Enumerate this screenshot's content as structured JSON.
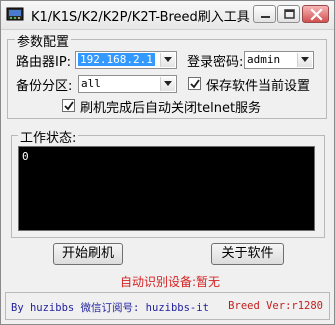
{
  "window": {
    "title": "K1/K1S/K2/K2P/K2T-Breed刷入工具",
    "app_icon": "app-icon",
    "controls": {
      "minimize": "minimize-icon",
      "maximize": "maximize-icon",
      "close": "close-icon"
    }
  },
  "params": {
    "group_label": "参数配置",
    "router_ip_label": "路由器IP:",
    "router_ip_value": "192.168.2.1",
    "password_label": "登录密码:",
    "password_value": "admin",
    "partition_label": "备份分区:",
    "partition_value": "all",
    "save_settings_label": "保存软件当前设置",
    "save_settings_checked": true,
    "auto_close_telnet_label": "刷机完成后自动关闭telnet服务",
    "auto_close_telnet_checked": true
  },
  "status": {
    "group_label": "工作状态:",
    "text": "0"
  },
  "actions": {
    "start_label": "开始刷机",
    "about_label": "关于软件"
  },
  "device": {
    "text": "自动识别设备:暂无"
  },
  "footer": {
    "author": "By huzibbs 微信订阅号: huzibbs-it",
    "version": "Breed Ver:r1280"
  },
  "colors": {
    "device_text": "#d42323",
    "author_text": "#1f1f9e",
    "version_text": "#c21f1f",
    "status_bg": "#000000",
    "selection": "#3399ff"
  }
}
